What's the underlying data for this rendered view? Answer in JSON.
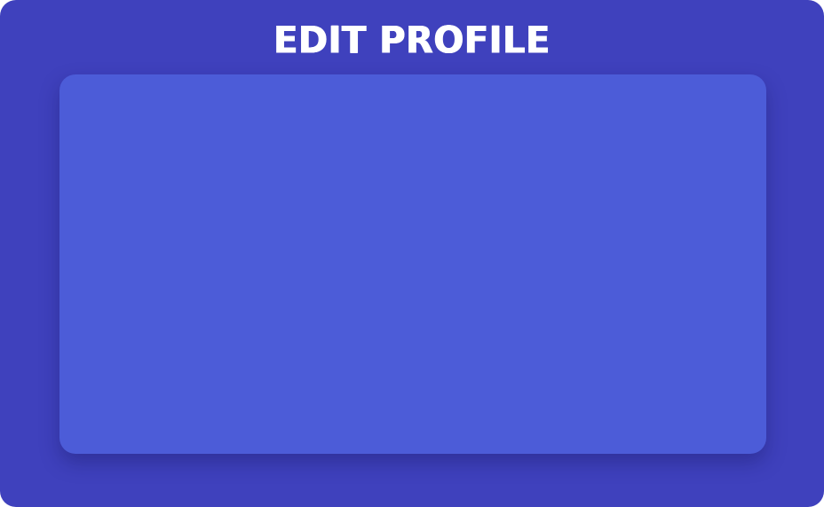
{
  "window": {
    "title": "EDIT PROFILE"
  },
  "colors": {
    "background": "#3f41bd",
    "panel": "#4c5cd8",
    "title_text": "#ffffff"
  }
}
